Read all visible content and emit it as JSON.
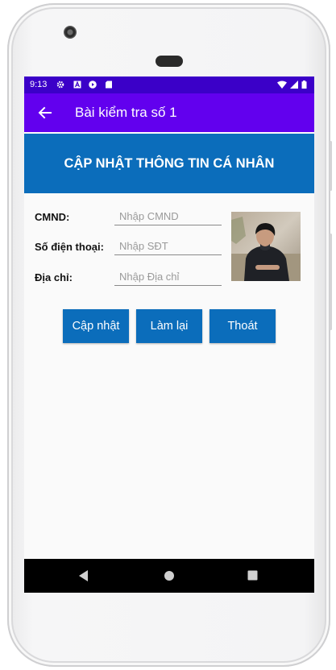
{
  "status_bar": {
    "time": "9:13",
    "left_icons": [
      "gear-icon",
      "a-icon",
      "play-icon",
      "sd-card-icon"
    ],
    "right_icons": [
      "wifi-icon",
      "signal-icon",
      "battery-icon"
    ],
    "color": "#3b00c8"
  },
  "app_bar": {
    "title": "Bài kiểm tra số 1",
    "back_icon": "arrow-left-icon",
    "color": "#6200ee"
  },
  "header": {
    "title": "CẬP NHẬT THÔNG TIN CÁ NHÂN",
    "color": "#0b6dbb"
  },
  "form": {
    "cmnd": {
      "label": "CMND:",
      "placeholder": "Nhập CMND",
      "value": ""
    },
    "phone": {
      "label": "Số điện thoại:",
      "placeholder": "Nhập SĐT",
      "value": ""
    },
    "address": {
      "label": "Địa chỉ:",
      "placeholder": "Nhập Địa chỉ",
      "value": ""
    }
  },
  "buttons": {
    "update": "Cập nhật",
    "reset": "Làm lại",
    "exit": "Thoát",
    "color": "#0b6dbb"
  },
  "nav_bar": {
    "icons": [
      "back-triangle-icon",
      "home-circle-icon",
      "recents-square-icon"
    ]
  }
}
